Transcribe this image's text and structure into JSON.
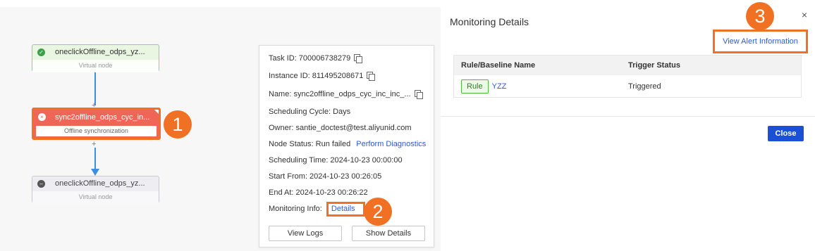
{
  "canvas": {
    "nodes": {
      "top": {
        "title": "oneclickOffline_odps_yz...",
        "subtitle": "Virtual node"
      },
      "mid": {
        "title": "sync2offline_odps_cyc_in...",
        "subtitle": "Offline synchronization"
      },
      "bottom": {
        "title": "oneclickOffline_odps_yz...",
        "subtitle": "Virtual node"
      }
    },
    "plus_symbol": "+"
  },
  "callouts": {
    "one": "1",
    "two": "2",
    "three": "3"
  },
  "popup": {
    "task_id": "Task ID: 700006738279",
    "instance_id": "Instance ID: 811495208671",
    "name": "Name: sync2offline_odps_cyc_inc_inc_...",
    "scheduling_cycle": "Scheduling Cycle: Days",
    "owner": "Owner: santie_doctest@test.aliyunid.com",
    "node_status": "Node Status: Run failed",
    "perform_diagnostics": "Perform Diagnostics",
    "scheduling_time": "Scheduling Time: 2024-10-23 00:00:00",
    "start_from": "Start From: 2024-10-23 00:26:05",
    "end_at": "End At: 2024-10-23 00:26:22",
    "monitoring_info": "Monitoring Info:",
    "details_link": "Details",
    "view_logs": "View Logs",
    "show_details": "Show Details"
  },
  "panel": {
    "title": "Monitoring Details",
    "close_icon": "×",
    "view_alert": "View Alert Information",
    "table": {
      "headers": [
        "Rule/Baseline Name",
        "Trigger Status"
      ],
      "rows": [
        {
          "tag": "Rule",
          "name": "YZZ",
          "status": "Triggered"
        }
      ]
    },
    "close_button": "Close"
  },
  "colors": {
    "accent_orange": "#f07124",
    "link_blue": "#2d5bd6",
    "failed_red": "#f06656",
    "success_green": "#3aa34a"
  }
}
